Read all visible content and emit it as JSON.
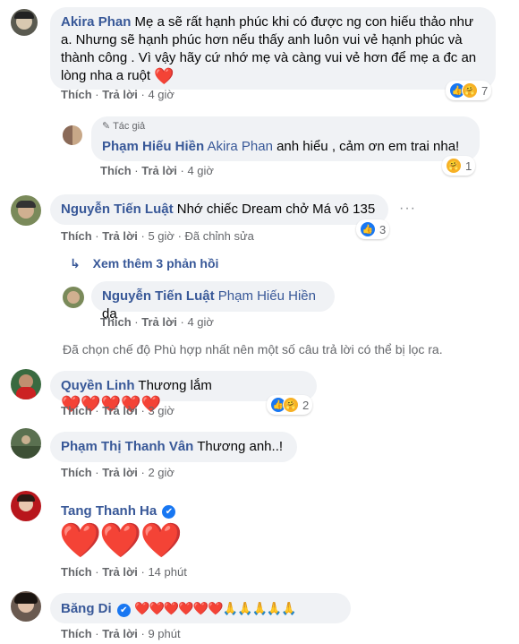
{
  "actions": {
    "like": "Thích",
    "reply": "Trả lời",
    "sep": "·",
    "edited": "Đã chỉnh sửa"
  },
  "comments": [
    {
      "name": "Akira Phan",
      "text": "Mẹ a sẽ rất hạnh phúc khi có được ng con hiếu thảo như a. Nhưng sẽ hạnh phúc hơn nếu thấy anh luôn vui vẻ hạnh phúc và thành công . Vì vậy hãy cứ nhớ mẹ và càng vui vẻ hơn để mẹ a đc an lòng nha a ruột",
      "emoji": "❤️",
      "time": "4 giờ",
      "reactions": "7"
    },
    {
      "author_badge": "Tác giả",
      "name": "Phạm Hiếu Hiền",
      "tag": "Akira Phan",
      "text": " anh hiểu , cảm ơn em trai nha!",
      "time": "4 giờ",
      "reactions": "1"
    },
    {
      "name": "Nguyễn Tiến Luật",
      "text": "Nhớ chiếc Dream chở Má vô 135",
      "time": "5 giờ",
      "reactions": "3",
      "more_dots": "···"
    },
    {
      "more_replies": "Xem thêm 3 phản hồi"
    },
    {
      "name": "Nguyễn Tiến Luật",
      "tag": "Phạm Hiếu Hiền",
      "text": " dạ",
      "time": "4 giờ"
    },
    {
      "filter_notice": "Đã chọn chế độ Phù hợp nhất nên một số câu trả lời có thể bị lọc ra."
    },
    {
      "name": "Quyền Linh",
      "text": "Thương lắm ",
      "emoji": "❤️❤️❤️❤️❤️",
      "time": "3 giờ",
      "reactions": "2"
    },
    {
      "name": "Phạm Thị Thanh Vân",
      "text": "Thương anh..!",
      "time": "2 giờ"
    },
    {
      "name": "Tang Thanh Ha",
      "verified": "✔",
      "emoji": "❤️❤️❤️",
      "time": "14 phút"
    },
    {
      "name": "Băng Di",
      "verified": "✔",
      "emoji": "❤️❤️❤️❤️❤️❤️🙏🙏🙏🙏🙏",
      "time": "9 phút"
    }
  ],
  "icons": {
    "like": "👍",
    "care": "🤗",
    "heart": "❤",
    "arrow": "↳",
    "pencil": "✎",
    "check": "✔"
  },
  "colors": {
    "name": "#385898",
    "bubble": "#f0f2f5",
    "meta": "#65676b",
    "like": "#1877f2",
    "heart": "#e4132b"
  }
}
